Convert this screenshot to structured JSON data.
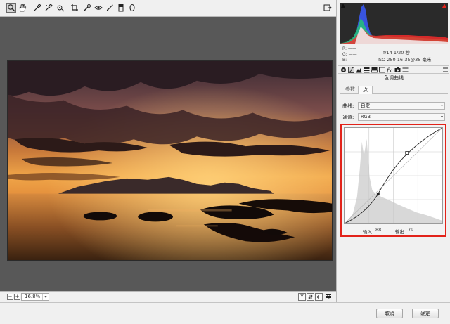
{
  "toolbar": {
    "tools": [
      "zoom-icon",
      "hand-icon",
      "eyedropper-icon",
      "color-sampler-icon",
      "target-adjust-icon",
      "crop-icon",
      "spot-removal-icon",
      "red-eye-icon",
      "brush-icon",
      "graduated-filter-icon",
      "radial-filter-icon"
    ],
    "active_tool": "zoom-icon"
  },
  "status": {
    "zoom_out": "−",
    "zoom_in": "+",
    "zoom_value": "16.8%",
    "zoom_arrow": "▾",
    "before_after_label": "Y"
  },
  "readout": {
    "r": "R:  ——",
    "g": "G:  ——",
    "b": "B:  ——",
    "exposure": "f/14   1/20 秒",
    "lens": "ISO 250   16-35@35 毫米"
  },
  "panel": {
    "title": "色调曲线",
    "subtabs": [
      "参数",
      "点"
    ],
    "active_subtab": "点",
    "curve_label": "曲线:",
    "curve_value": "自定",
    "channel_label": "通道:",
    "channel_value": "RGB",
    "dropdown_arrow": "▾",
    "input_label": "输入",
    "input_value": "88",
    "output_label": "输出",
    "output_value": "79"
  },
  "colors": {
    "highlight_frame": "#e2231a"
  },
  "footer": {
    "cancel_label": "取消",
    "ok_label": "确定"
  }
}
